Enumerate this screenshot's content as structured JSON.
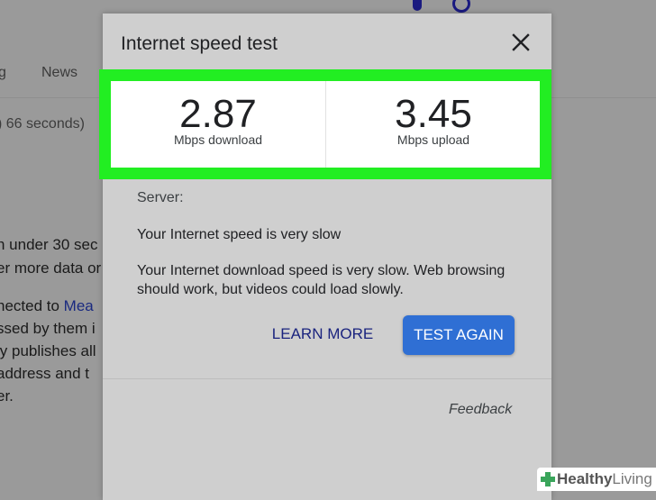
{
  "background": {
    "tab_partial": "g",
    "tab_news": "News",
    "result_stats": ") 66 seconds)",
    "lines": [
      "n under 30 sec",
      "er more data or",
      "nected to ",
      "ssed by them i",
      "ly publishes all",
      " address and t",
      "er."
    ],
    "link_text": "Mea"
  },
  "dialog": {
    "title": "Internet speed test",
    "close_icon": "close-icon",
    "download": {
      "value": "2.87",
      "unit": "Mbps download"
    },
    "upload": {
      "value": "3.45",
      "unit": "Mbps upload"
    },
    "server_label": "Server:",
    "status": "Your Internet speed is very slow",
    "description": "Your Internet download speed is very slow. Web browsing should work, but videos could load slowly.",
    "learn_more_label": "LEARN MORE",
    "test_again_label": "TEST AGAIN",
    "feedback_label": "Feedback"
  },
  "watermark": {
    "brand_bold": "Healthy",
    "brand_light": "Living"
  },
  "colors": {
    "highlight": "#22ee22",
    "primary_button": "#2f6fd4",
    "link": "#1a237e",
    "dim_background": "#9a9a9a",
    "dialog_background": "#cfcfcf"
  }
}
